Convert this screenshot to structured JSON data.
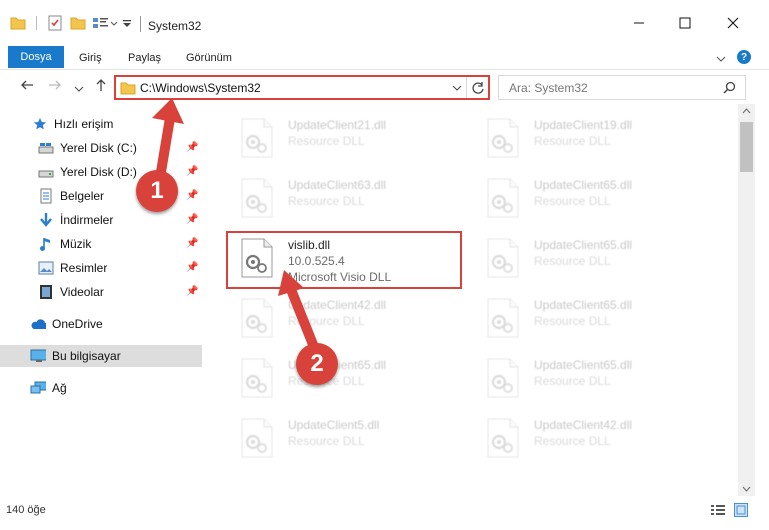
{
  "window": {
    "title": "System32"
  },
  "ribbon": {
    "tabs": [
      "Dosya",
      "Giriş",
      "Paylaş",
      "Görünüm"
    ]
  },
  "nav": {
    "path": "C:\\Windows\\System32",
    "search_placeholder": "Ara: System32"
  },
  "sidebar": {
    "items": [
      {
        "label": "Hızlı erişim",
        "icon": "star-icon"
      },
      {
        "label": "Yerel Disk (C:)",
        "icon": "drive-icon"
      },
      {
        "label": "Yerel Disk (D:)",
        "icon": "drive-icon"
      },
      {
        "label": "Belgeler",
        "icon": "documents-icon"
      },
      {
        "label": "İndirmeler",
        "icon": "download-icon"
      },
      {
        "label": "Müzik",
        "icon": "music-icon"
      },
      {
        "label": "Resimler",
        "icon": "pictures-icon"
      },
      {
        "label": "Videolar",
        "icon": "video-icon"
      },
      {
        "label": "OneDrive",
        "icon": "cloud-icon"
      },
      {
        "label": "Bu bilgisayar",
        "icon": "computer-icon"
      },
      {
        "label": "Ağ",
        "icon": "network-icon"
      }
    ]
  },
  "files": [
    {
      "name": "UpdateClient21.dll",
      "desc": "Resource DLL"
    },
    {
      "name": "UpdateClient19.dll",
      "desc": "Resource DLL"
    },
    {
      "name": "UpdateClient63.dll",
      "desc": "Resource DLL"
    },
    {
      "name": "UpdateClient65.dll",
      "desc": "Resource DLL"
    },
    {
      "name": "vislib.dll",
      "version": "10.0.525.4",
      "desc": "Microsoft Visio DLL"
    },
    {
      "name": "UpdateClient65.dll",
      "desc": "Resource DLL"
    },
    {
      "name": "UpdateClient42.dll",
      "desc": "Resource DLL"
    },
    {
      "name": "UpdateClient65.dll",
      "desc": "Resource DLL"
    },
    {
      "name": "UpdateClient65.dll",
      "desc": "Resource DLL"
    },
    {
      "name": "UpdateClient65.dll",
      "desc": "Resource DLL"
    },
    {
      "name": "UpdateClient5.dll",
      "desc": "Resource DLL"
    },
    {
      "name": "UpdateClient42.dll",
      "desc": "Resource DLL"
    }
  ],
  "status": {
    "item_count": "140 öğe"
  },
  "callouts": [
    "1",
    "2"
  ],
  "colors": {
    "accent": "#1979ca",
    "highlight": "#d9413b"
  }
}
